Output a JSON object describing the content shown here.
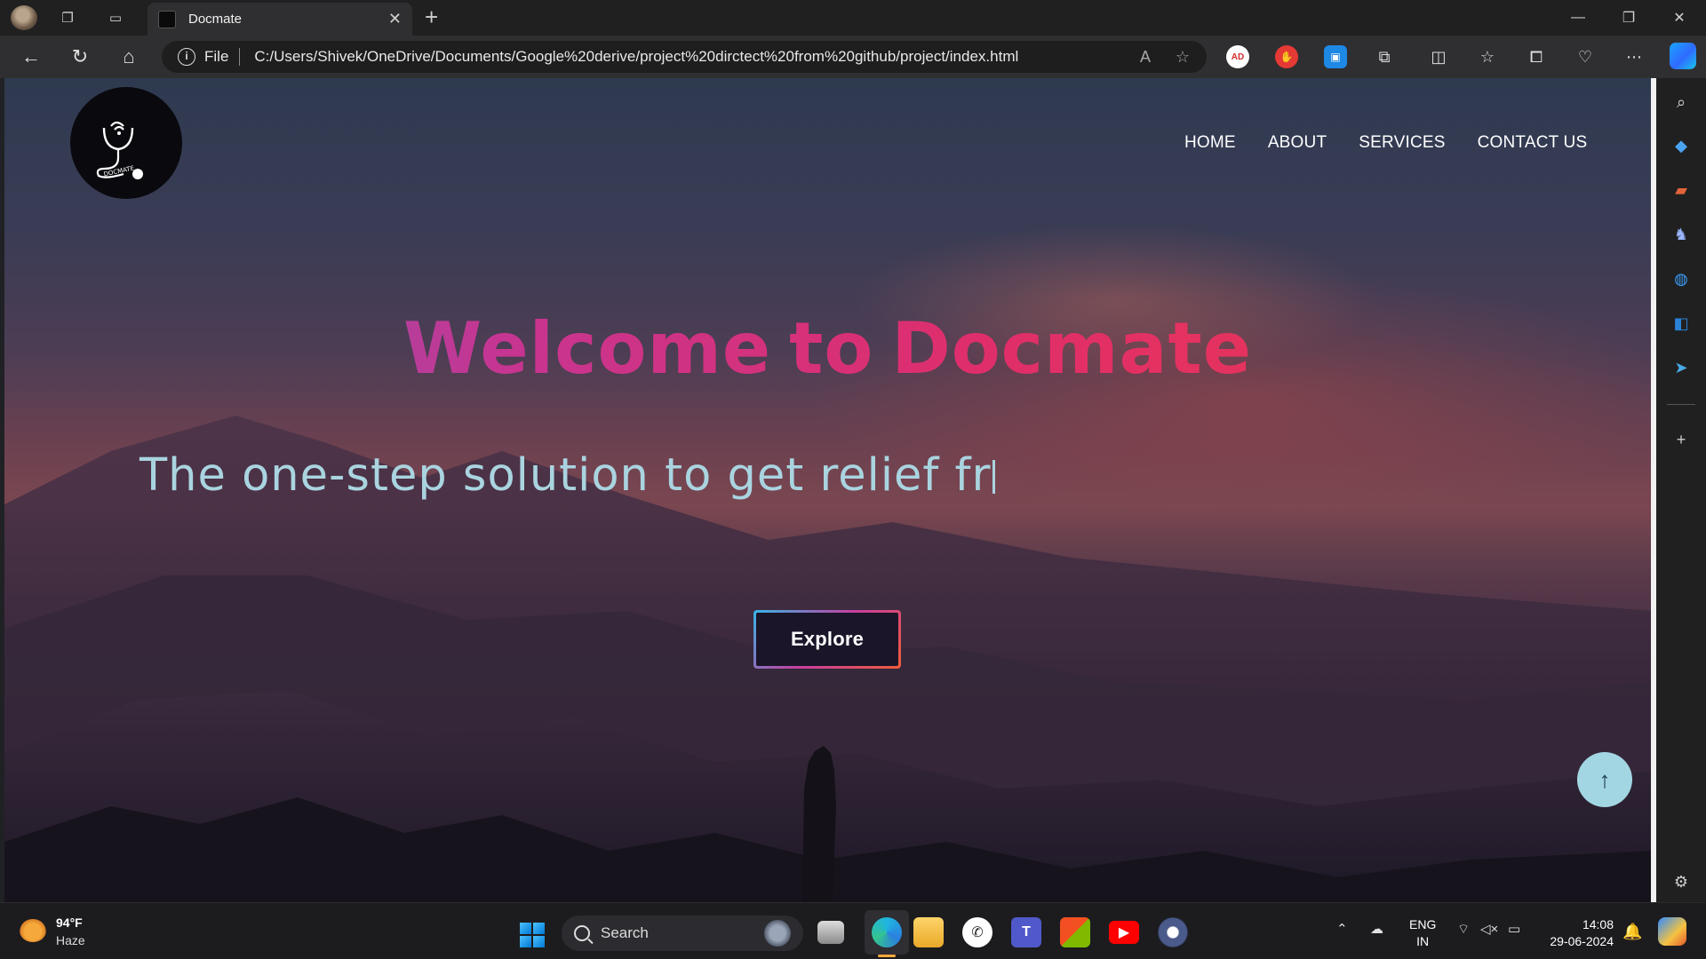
{
  "browser": {
    "tab_title": "Docmate",
    "tab_close": "✕",
    "new_tab": "+",
    "address_scheme": "File",
    "url": "C:/Users/Shivek/OneDrive/Documents/Google%20derive/project%20dirctect%20from%20github/project/index.html",
    "extensions": [
      {
        "name": "adblock-icon",
        "label": "AD",
        "color": "#d62d2d"
      },
      {
        "name": "stop-icon",
        "label": "✋",
        "color": "#e53935"
      },
      {
        "name": "screenshot-icon",
        "label": "▣",
        "color": "#1e88e5"
      }
    ]
  },
  "page": {
    "nav": {
      "home": "HOME",
      "about": "ABOUT",
      "services": "SERVICES",
      "contact": "CONTACT US"
    },
    "logo_text": "DOCMATE",
    "hero_title_1": "Welcome",
    "hero_title_2": "to",
    "hero_title_3": "Docmate",
    "hero_subtitle": "The one-step solution to get relief fr",
    "explore_button": "Explore",
    "scroll_top_icon": "arrow-up-icon"
  },
  "taskbar": {
    "weather_temp": "94°F",
    "weather_desc": "Haze",
    "search_placeholder": "Search",
    "lang_line1": "ENG",
    "lang_line2": "IN",
    "time": "14:08",
    "date": "29-06-2024"
  },
  "colors": {
    "accent": "#a3d6e3",
    "title_gradient_start": "#6a5ca8",
    "title_gradient_end": "#ec3a4c",
    "subtitle": "#a9d4e0"
  }
}
